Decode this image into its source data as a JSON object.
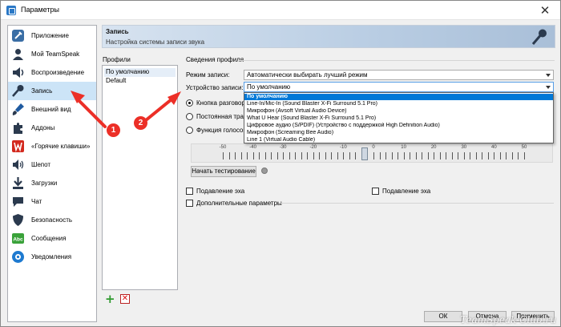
{
  "window": {
    "title": "Параметры"
  },
  "sidebar": {
    "items": [
      {
        "label": "Приложение",
        "icon": "wrench-icon",
        "color": "#3a6ea5"
      },
      {
        "label": "Мой TeamSpeak",
        "icon": "user-icon",
        "color": "#2b3a4e"
      },
      {
        "label": "Воспроизведение",
        "icon": "speaker-icon",
        "color": "#2b3a4e"
      },
      {
        "label": "Запись",
        "icon": "microphone-icon",
        "color": "#2b3a4e",
        "active": true
      },
      {
        "label": "Внешний вид",
        "icon": "brush-icon",
        "color": "#1f5aa0"
      },
      {
        "label": "Аддоны",
        "icon": "puzzle-icon",
        "color": "#2b3a4e"
      },
      {
        "label": "«Горячие клавиши»",
        "icon": "hotkeys-icon",
        "color": "#d32a1f"
      },
      {
        "label": "Шепот",
        "icon": "whisper-icon",
        "color": "#2b3a4e"
      },
      {
        "label": "Загрузки",
        "icon": "downloads-icon",
        "color": "#2b3a4e"
      },
      {
        "label": "Чат",
        "icon": "chat-icon",
        "color": "#2b3a4e"
      },
      {
        "label": "Безопасность",
        "icon": "shield-icon",
        "color": "#2b3a4e"
      },
      {
        "label": "Сообщения",
        "icon": "messages-icon",
        "color": "#3aa23a"
      },
      {
        "label": "Уведомления",
        "icon": "notifications-icon",
        "color": "#1e7ad0"
      }
    ]
  },
  "banner": {
    "title": "Запись",
    "subtitle": "Настройка системы записи звука"
  },
  "profiles": {
    "label": "Профили",
    "items": [
      "По умолчанию",
      "Default"
    ],
    "selected": 0
  },
  "settings": {
    "group_label": "Сведения профиля",
    "mode_label": "Режим записи:",
    "mode_value": "Автоматически выбирать лучший режим",
    "device_label": "Устройство записи:",
    "device_value": "По умолчанию",
    "device_options": [
      "По умолчанию",
      "Line-In/Mic-In (Sound Blaster X-Fi Surround 5.1 Pro)",
      "Микрофон (Avsoft Virtual Audio Device)",
      "What U Hear (Sound Blaster X-Fi Surround 5.1 Pro)",
      "Цифровое аудио (S/PDIF) (Устройство с поддержкой High Definition Audio)",
      "Микрофон (Screaming Bee Audio)",
      "Line 1 (Virtual Audio Cable)"
    ],
    "radio_options": [
      "Кнопка разговора",
      "Постоянная тран",
      "Функция голосов"
    ],
    "radio_selected": 0,
    "slider_ticks": [
      "-50",
      "-40",
      "-30",
      "-20",
      "-10",
      "0",
      "10",
      "20",
      "30",
      "40",
      "50"
    ],
    "test_button": "Начать тестирование",
    "echo_left": "Подавление эха",
    "echo_right": "Подавление эха",
    "advanced": "Дополнительные параметры"
  },
  "footer": {
    "ok": "ОК",
    "cancel": "Отмена",
    "apply": "Применить"
  },
  "annotations": [
    "1",
    "2"
  ],
  "watermark": "TeamSpeak-Club.ru",
  "colors": {
    "accent": "#0078d7",
    "annotation": "#ec2f27",
    "selection": "#cce4f7"
  }
}
